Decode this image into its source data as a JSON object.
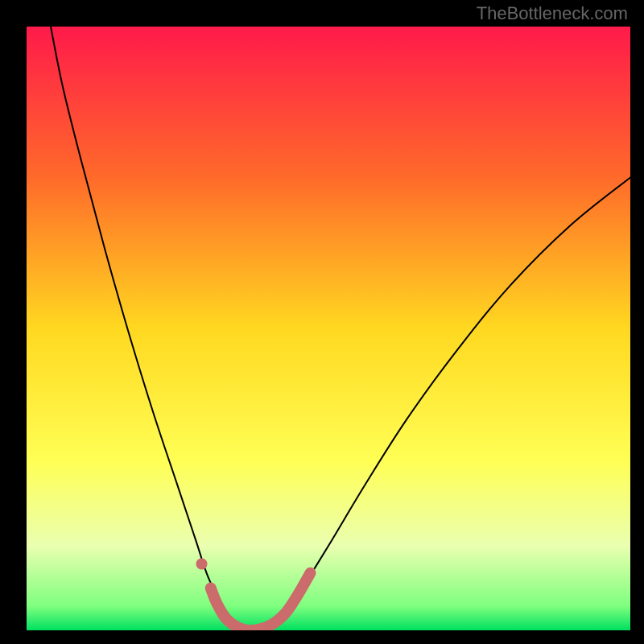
{
  "watermark": "TheBottleneck.com",
  "chart_data": {
    "type": "line",
    "title": "",
    "xlabel": "",
    "ylabel": "",
    "xlim": [
      0,
      100
    ],
    "ylim": [
      0,
      100
    ],
    "background_gradient": {
      "stops": [
        {
          "offset": 0.0,
          "color": "#ff1a4a"
        },
        {
          "offset": 0.25,
          "color": "#ff6a2a"
        },
        {
          "offset": 0.5,
          "color": "#ffd820"
        },
        {
          "offset": 0.72,
          "color": "#ffff55"
        },
        {
          "offset": 0.86,
          "color": "#eaffb0"
        },
        {
          "offset": 0.96,
          "color": "#7fff7f"
        },
        {
          "offset": 1.0,
          "color": "#00e060"
        }
      ]
    },
    "series": [
      {
        "name": "bottleneck-curve",
        "stroke": "#000000",
        "stroke_width": 2,
        "points": [
          {
            "x": 4,
            "y": 100
          },
          {
            "x": 6,
            "y": 90
          },
          {
            "x": 9,
            "y": 78
          },
          {
            "x": 13,
            "y": 63
          },
          {
            "x": 17,
            "y": 49
          },
          {
            "x": 21,
            "y": 36
          },
          {
            "x": 25,
            "y": 24
          },
          {
            "x": 28,
            "y": 15
          },
          {
            "x": 30,
            "y": 9
          },
          {
            "x": 32,
            "y": 5
          },
          {
            "x": 34,
            "y": 2
          },
          {
            "x": 36,
            "y": 0.5
          },
          {
            "x": 38,
            "y": 0
          },
          {
            "x": 40,
            "y": 0.5
          },
          {
            "x": 42,
            "y": 2
          },
          {
            "x": 45,
            "y": 6
          },
          {
            "x": 50,
            "y": 14
          },
          {
            "x": 56,
            "y": 24
          },
          {
            "x": 63,
            "y": 35
          },
          {
            "x": 71,
            "y": 46
          },
          {
            "x": 80,
            "y": 57
          },
          {
            "x": 90,
            "y": 67
          },
          {
            "x": 100,
            "y": 75
          }
        ]
      },
      {
        "name": "highlight-band",
        "stroke": "#cc6b6b",
        "stroke_width": 14,
        "points": [
          {
            "x": 30.5,
            "y": 7
          },
          {
            "x": 31.5,
            "y": 4.5
          },
          {
            "x": 33,
            "y": 2
          },
          {
            "x": 35,
            "y": 0.5
          },
          {
            "x": 37,
            "y": 0
          },
          {
            "x": 39,
            "y": 0.3
          },
          {
            "x": 41,
            "y": 1.2
          },
          {
            "x": 43,
            "y": 3
          },
          {
            "x": 45,
            "y": 6
          },
          {
            "x": 47,
            "y": 9.5
          }
        ]
      },
      {
        "name": "highlight-dot",
        "type": "scatter",
        "fill": "#cc6b6b",
        "radius": 7,
        "points": [
          {
            "x": 29,
            "y": 11
          }
        ]
      }
    ]
  }
}
